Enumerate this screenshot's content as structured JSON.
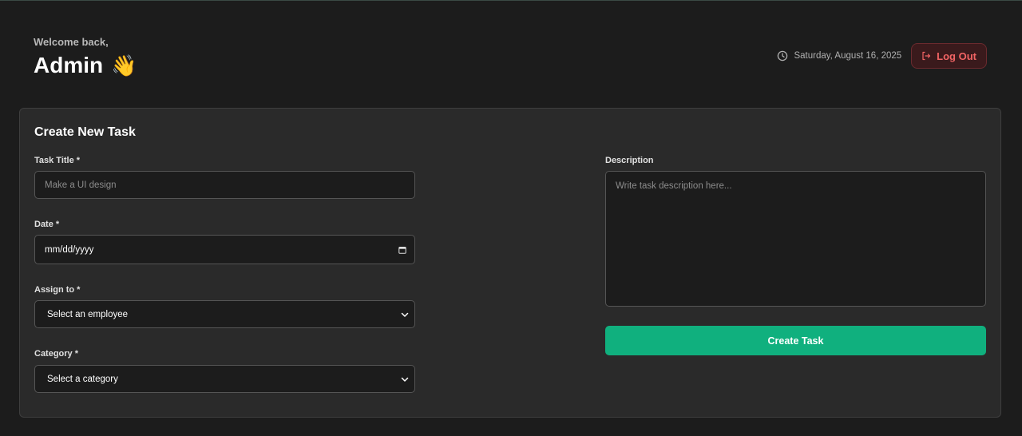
{
  "header": {
    "welcome": "Welcome back,",
    "name": "Admin",
    "wave_emoji": "👋",
    "date": "Saturday, August 16, 2025",
    "logout_label": "Log Out"
  },
  "form": {
    "title": "Create New Task",
    "task_title": {
      "label": "Task Title *",
      "placeholder": "Make a UI design"
    },
    "date": {
      "label": "Date *",
      "value": "mm/dd/yyyy"
    },
    "assign_to": {
      "label": "Assign to *",
      "selected": "Select an employee"
    },
    "category": {
      "label": "Category *",
      "selected": "Select a category"
    },
    "description": {
      "label": "Description",
      "placeholder": "Write task description here..."
    },
    "submit_label": "Create Task"
  },
  "colors": {
    "background": "#1c1c1c",
    "card": "#2a2a2a",
    "accent": "#10b07e",
    "logout": "#f26464"
  },
  "icons": [
    "clock-icon",
    "logout-icon",
    "calendar-icon",
    "chevron-down-icon"
  ]
}
